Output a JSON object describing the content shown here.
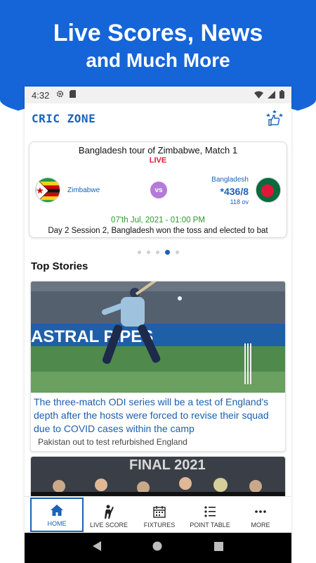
{
  "promo": {
    "line1": "Live Scores, News",
    "line2": "and Much More"
  },
  "status_bar": {
    "time": "4:32",
    "left_icons": [
      "gear-icon",
      "sd-card-icon"
    ],
    "right_icons": [
      "wifi-icon",
      "signal-icon",
      "battery-icon"
    ]
  },
  "app_bar": {
    "logo": "CRIC ZONE",
    "action_icon": "thumbs-up-stars-icon"
  },
  "match": {
    "title": "Bangladesh tour of Zimbabwe, Match 1",
    "live": "LIVE",
    "team1": {
      "name": "Zimbabwe",
      "flag": "zimbabwe-flag"
    },
    "vs": "vs",
    "team2": {
      "name": "Bangladesh",
      "score": "*436/8",
      "overs": "118 ov",
      "flag": "bangladesh-flag"
    },
    "date": "07'th Jul, 2021 - 01:00 PM",
    "status": "Day 2 Session 2, Bangladesh won the toss and elected to bat"
  },
  "carousel": {
    "count": 5,
    "active_index": 3
  },
  "top_stories": {
    "title": "Top Stories",
    "stories": [
      {
        "headline": "The three-match ODI series will be a test of England's depth after the hosts were forced to revise their squad due to COVID cases within the camp",
        "sub": "Pakistan out to test refurbished England",
        "banner_text": "ASTRAL PIPES"
      },
      {
        "banner_text": "FINAL 2021"
      }
    ]
  },
  "bottom_nav": {
    "items": [
      {
        "label": "HOME",
        "icon": "home-icon",
        "active": true
      },
      {
        "label": "LIVE SCORE",
        "icon": "cricket-player-icon",
        "active": false
      },
      {
        "label": "FIXTURES",
        "icon": "calendar-icon",
        "active": false
      },
      {
        "label": "POINT TABLE",
        "icon": "list-icon",
        "active": false
      },
      {
        "label": "MORE",
        "icon": "more-icon",
        "active": false
      }
    ]
  },
  "colors": {
    "brand_blue": "#1565d8",
    "live_red": "#e0173b",
    "link_blue": "#1a5fae",
    "date_green": "#2a9a2a",
    "vs_purple": "#b57bd8"
  }
}
